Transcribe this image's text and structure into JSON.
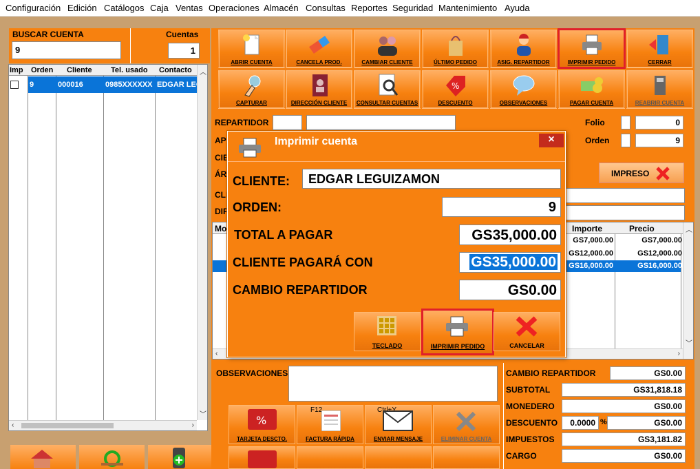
{
  "menu": [
    "Configuración",
    "Edición",
    "Catálogos",
    "Caja",
    "Ventas",
    "Operaciones",
    "Almacén",
    "Consultas",
    "Reportes",
    "Seguridad",
    "Mantenimiento",
    "Ayuda"
  ],
  "search": {
    "label": "BUSCAR CUENTA",
    "value": "9",
    "count_label": "Cuentas",
    "count": "1"
  },
  "accounts_table": {
    "headers": [
      "Imp",
      "Orden",
      "Cliente",
      "Tel. usado",
      "Contacto"
    ],
    "rows": [
      {
        "orden": "9",
        "cliente": "000016",
        "tel": "0985XXXXXX",
        "contacto": "EDGAR LEG"
      }
    ]
  },
  "toolbar_row1": [
    "ABRIR CUENTA",
    "CANCELA PROD.",
    "CAMBIAR CLIENTE",
    "ÚLTIMO PEDIDO",
    "ASIG. REPARTIDOR",
    "IMPRIMIR PEDIDO",
    "CERRAR"
  ],
  "toolbar_row2": [
    "CAPTURAR",
    "DIRECCIÓN CLIENTE",
    "CONSULTAR CUENTAS",
    "DESCUENTO",
    "OBSERVACIONES",
    "PAGAR CUENTA",
    "REABRIR CUENTA"
  ],
  "order": {
    "repartidor_label": "REPARTIDOR",
    "ap_label": "AP",
    "cie_label": "CIE",
    "ar_label": "ÁR",
    "cli_label": "CLI",
    "dir_label": "DIR",
    "folio_label": "Folio",
    "folio": "0",
    "orden_label": "Orden",
    "orden": "9",
    "impreso_label": "IMPRESO"
  },
  "items_table": {
    "headers": [
      "Mo",
      "Importe",
      "Precio"
    ],
    "rows": [
      {
        "importe": "GS7,000.00",
        "precio": "GS7,000.00"
      },
      {
        "importe": "GS12,000.00",
        "precio": "GS12,000.00"
      },
      {
        "importe": "GS16,000.00",
        "precio": "GS16,000.00"
      }
    ]
  },
  "observaciones_label": "OBSERVACIONES",
  "bottom_buttons": [
    {
      "label": "TARJETA DESCTO.",
      "hint": ""
    },
    {
      "label": "FACTURA RÁPIDA",
      "hint": "F12"
    },
    {
      "label": "ENVIAR MENSAJE",
      "hint": "Ctrl+Y"
    },
    {
      "label": "ELIMINAR CUENTA",
      "hint": ""
    }
  ],
  "summary": {
    "cambio_label": "CAMBIO REPARTIDOR",
    "cambio": "GS0.00",
    "subtotal_label": "SUBTOTAL",
    "subtotal": "GS31,818.18",
    "monedero_label": "MONEDERO",
    "monedero": "GS0.00",
    "descuento_label": "DESCUENTO",
    "descuento_pct": "0.0000",
    "pct_sign": "%",
    "descuento": "GS0.00",
    "impuestos_label": "IMPUESTOS",
    "impuestos": "GS3,181.82",
    "cargo_label": "CARGO",
    "cargo": "GS0.00"
  },
  "dialog": {
    "title": "Imprimir cuenta",
    "close": "×",
    "cliente_label": "CLIENTE:",
    "cliente": "EDGAR LEGUIZAMON",
    "orden_label": "ORDEN:",
    "orden": "9",
    "total_label": "TOTAL A PAGAR",
    "total": "GS35,000.00",
    "pagara_label": "CLIENTE PAGARÁ CON",
    "pagara": "GS35,000.00",
    "cambio_label": "CAMBIO REPARTIDOR",
    "cambio": "GS0.00",
    "buttons": [
      "TECLADO",
      "IMPRIMIR PEDIDO",
      "CANCELAR"
    ]
  },
  "colors": {
    "accent": "#f7810f",
    "selection": "#0a74d8",
    "highlight": "#e0202a"
  }
}
